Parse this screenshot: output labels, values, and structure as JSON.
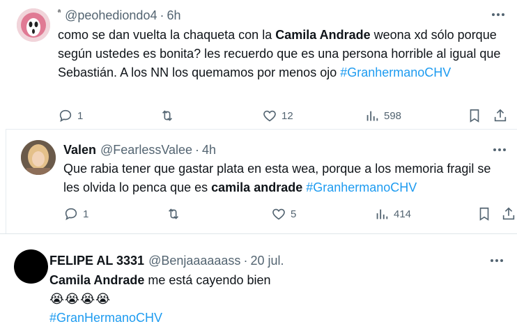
{
  "tweets": [
    {
      "name": "ª",
      "handle": "@peohediondo4",
      "time": "6h",
      "text_parts": [
        {
          "t": "como se dan vuelta la chaqueta con la ",
          "style": "normal"
        },
        {
          "t": "Camila Andrade",
          "style": "bold"
        },
        {
          "t": " weona xd sólo porque según ustedes es bonita? les recuerdo que es una persona horrible al igual que Sebastián. A los NN los quemamos por menos ojo ",
          "style": "normal"
        },
        {
          "t": "#GranhermanoCHV",
          "style": "tag"
        }
      ],
      "replies": "1",
      "likes": "12",
      "views": "598"
    },
    {
      "name": "Valen",
      "handle": "@FearlessValee",
      "time": "4h",
      "text_parts": [
        {
          "t": "Que rabia tener que gastar plata en esta wea, porque a los memoria fragil se les olvida lo penca que es ",
          "style": "normal"
        },
        {
          "t": "camila andrade",
          "style": "bold"
        },
        {
          "t": " ",
          "style": "normal"
        },
        {
          "t": "#GranhermanoCHV",
          "style": "tag"
        }
      ],
      "replies": "1",
      "likes": "5",
      "views": "414"
    },
    {
      "name": "FELIPE AL 3331",
      "handle": "@Benjaaaaaass",
      "time": "20 jul.",
      "line1_bold": "Camila Andrade",
      "line1_rest": " me está cayendo bien",
      "emojis": "😭😭😭😭",
      "hashtag": "#GranHermanoCHV"
    }
  ],
  "separator": "·",
  "colors": {
    "accent": "#1d9bf0",
    "muted": "#536471",
    "text": "#0f1419"
  },
  "icons": [
    "reply-icon",
    "retweet-icon",
    "like-icon",
    "views-icon",
    "bookmark-icon",
    "share-icon",
    "more-icon"
  ]
}
